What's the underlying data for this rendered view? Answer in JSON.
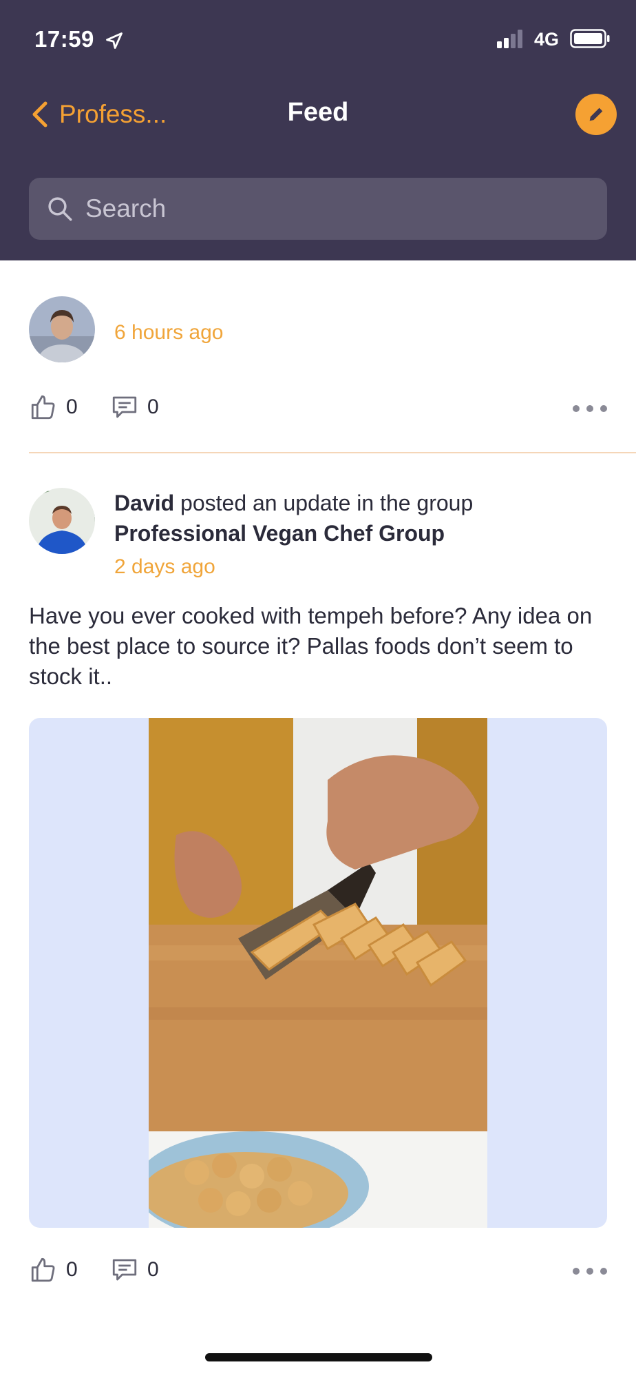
{
  "status_bar": {
    "time": "17:59",
    "network": "4G"
  },
  "nav": {
    "back_label": "Profess...",
    "title": "Feed"
  },
  "search": {
    "placeholder": "Search"
  },
  "posts": [
    {
      "author": "",
      "timestamp": "6 hours ago",
      "likes": "0",
      "comments": "0"
    },
    {
      "author": "David",
      "action_text": " posted an update in the group",
      "group": "Professional Vegan Chef Group",
      "timestamp": "2 days ago",
      "body": "Have you ever cooked with tempeh before? Any idea on the best place to source it? Pallas foods don’t seem to stock it..",
      "likes": "0",
      "comments": "0"
    }
  ],
  "colors": {
    "header_bg": "#3d3752",
    "accent": "#f5a133",
    "search_bg": "#5a556c",
    "media_bg": "#dde5fb"
  },
  "icons": [
    "location-arrow-icon",
    "signal-icon",
    "battery-icon",
    "chevron-left-icon",
    "pencil-icon",
    "search-icon",
    "thumbs-up-icon",
    "comment-icon",
    "more-icon"
  ]
}
